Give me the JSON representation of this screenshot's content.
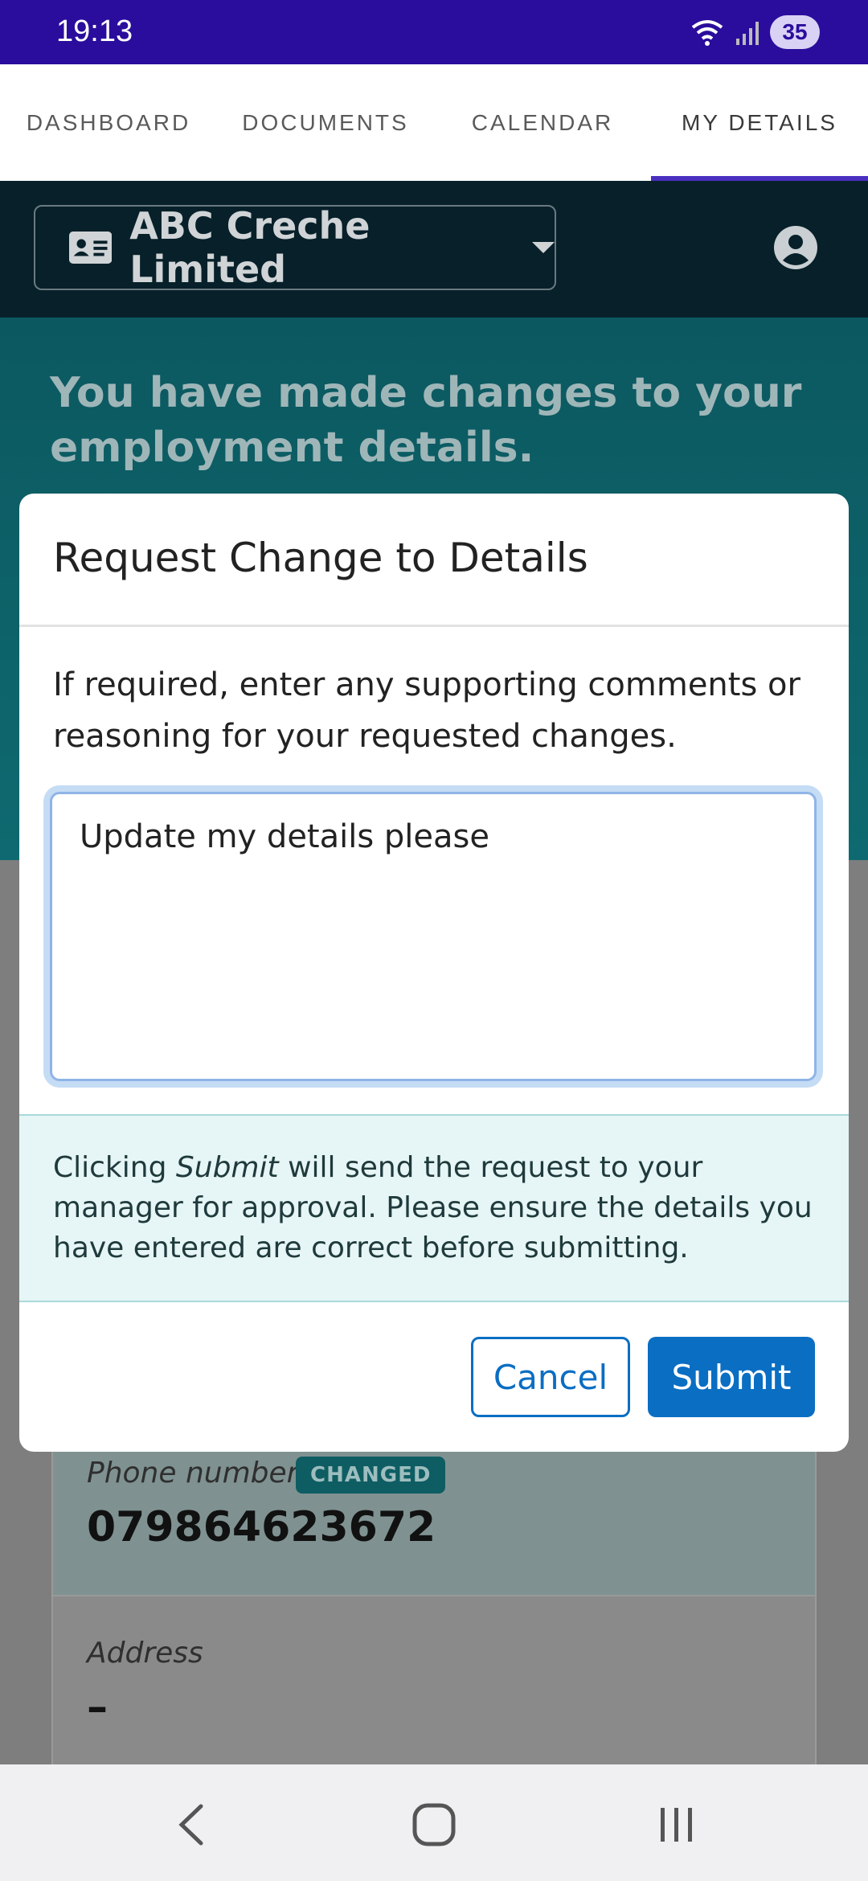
{
  "status_bar": {
    "time": "19:13",
    "battery": "35"
  },
  "tabs": [
    {
      "label": "DASHBOARD"
    },
    {
      "label": "DOCUMENTS"
    },
    {
      "label": "CALENDAR"
    },
    {
      "label": "MY DETAILS"
    }
  ],
  "header": {
    "org_name": "ABC Creche Limited"
  },
  "banner": {
    "text": "You have made changes to your employment details."
  },
  "modal": {
    "title": "Request Change to Details",
    "description": "If required, enter any supporting comments or reasoning for your requested changes.",
    "comment_value": "Update my details please",
    "info_prefix": "Clicking ",
    "info_emphasis": "Submit",
    "info_suffix": " will send the request to your manager for approval. Please ensure the details you have entered are correct before submitting.",
    "cancel_label": "Cancel",
    "submit_label": "Submit"
  },
  "details": {
    "phone_label": "Phone number",
    "phone_badge": "CHANGED",
    "phone_value": "079864623672",
    "address_label": "Address",
    "address_value": "–"
  },
  "colors": {
    "accent": "#0a6ec3",
    "status_bar": "#2a0d9c",
    "banner": "#0e6a70"
  }
}
